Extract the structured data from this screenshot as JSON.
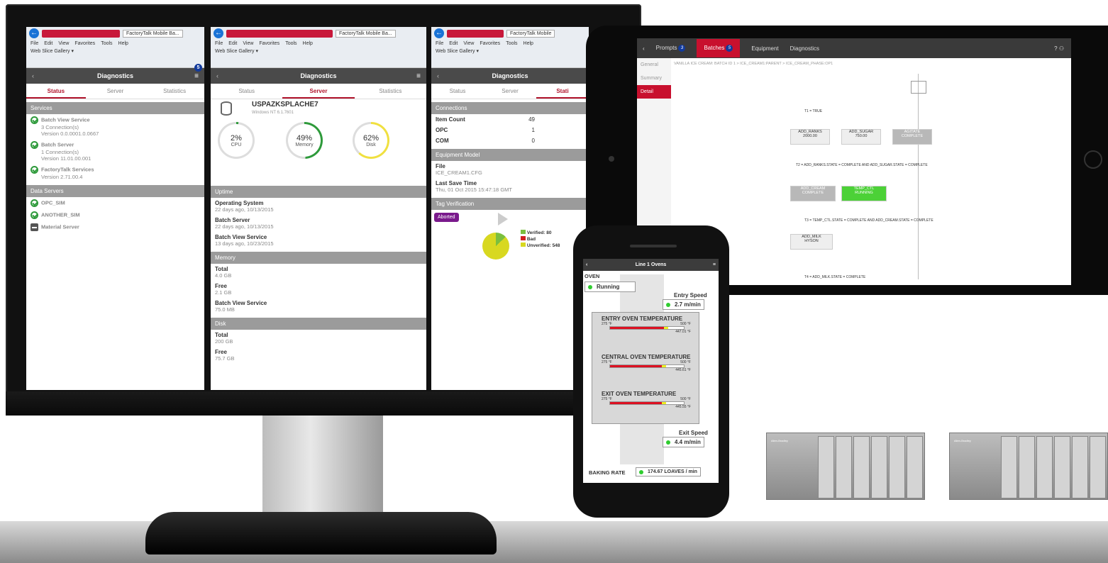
{
  "monitor": {
    "browser": {
      "menu": [
        "File",
        "Edit",
        "View",
        "Favorites",
        "Tools",
        "Help"
      ],
      "favorites": "Web Slice Gallery ▾",
      "tab_title": "FactoryTalk Mobile Ba...",
      "tab_title_short": "FactoryTalk Mobile"
    },
    "panel_left": {
      "title": "Diagnostics",
      "badge": "5",
      "tabs": [
        "Status",
        "Server",
        "Statistics"
      ],
      "services_header": "Services",
      "services": [
        {
          "name": "Batch View Service",
          "line1": "3 Connection(s)",
          "line2": "Version 0.0.0001.0.0667"
        },
        {
          "name": "Batch Server",
          "line1": "1 Connection(s)",
          "line2": "Version 11.01.00.001"
        },
        {
          "name": "FactoryTalk Services",
          "line1": "",
          "line2": "Version 2.71.00.4"
        }
      ],
      "data_servers_header": "Data Servers",
      "data_servers": [
        "OPC_SIM",
        "ANOTHER_SIM",
        "Material Server"
      ]
    },
    "panel_mid": {
      "title": "Diagnostics",
      "tabs": [
        "Status",
        "Server",
        "Statistics"
      ],
      "server_name": "USPAZKSPLACHE7",
      "server_os": "Windows NT 6.1.7601",
      "gauges": [
        {
          "value": "2%",
          "label": "CPU",
          "pct": 2,
          "color": "#2e9a3b"
        },
        {
          "value": "49%",
          "label": "Memory",
          "pct": 49,
          "color": "#2e9a3b"
        },
        {
          "value": "62%",
          "label": "Disk",
          "pct": 62,
          "color": "#f0e040"
        }
      ],
      "uptime_header": "Uptime",
      "uptime": [
        {
          "name": "Operating System",
          "value": "22 days ago, 10/13/2015"
        },
        {
          "name": "Batch Server",
          "value": "22 days ago, 10/13/2015"
        },
        {
          "name": "Batch View Service",
          "value": "13 days ago, 10/23/2015"
        }
      ],
      "memory_header": "Memory",
      "memory": [
        {
          "name": "Total",
          "value": "4.0 GB"
        },
        {
          "name": "Free",
          "value": "2.1 GB"
        },
        {
          "name": "Batch View Service",
          "value": "75.0 MB"
        }
      ],
      "disk_header": "Disk",
      "disk": [
        {
          "name": "Total",
          "value": "200 GB"
        },
        {
          "name": "Free",
          "value": "75.7 GB"
        }
      ]
    },
    "panel_right": {
      "title": "Diagnostics",
      "tabs": [
        "Status",
        "Server",
        "Stati"
      ],
      "connections_header": "Connections",
      "connections": [
        {
          "name": "Item Count",
          "value": "49"
        },
        {
          "name": "OPC",
          "value": "1"
        },
        {
          "name": "COM",
          "value": "0"
        }
      ],
      "equipment_header": "Equipment Model",
      "file_label": "File",
      "file_value": "ICE_CREAM1.CFG",
      "save_label": "Last Save Time",
      "save_value": "Thu, 01 Oct 2015 15:47:18 GMT",
      "tag_header": "Tag Verification",
      "aborted": "Aborted",
      "legend": [
        {
          "label": "Verified: 80",
          "color": "#7bbf3e"
        },
        {
          "label": "Bad",
          "color": "#d12020"
        },
        {
          "label": "Unverified: 548",
          "color": "#d8d820"
        }
      ]
    }
  },
  "tablet": {
    "nav": [
      {
        "label": "Prompts",
        "badge": "3"
      },
      {
        "label": "Batches",
        "badge": "5"
      },
      {
        "label": "Equipment",
        "badge": ""
      },
      {
        "label": "Diagnostics",
        "badge": ""
      }
    ],
    "side": [
      "General",
      "Summary",
      "Detail"
    ],
    "breadcrumb": "VANILLA ICE CREAM: BATCH ID 1  >  ICE_CREAM1:PARENT  >  ICE_CREAM_PHASE:OP1",
    "steps": [
      {
        "label": "ADD_RANKS",
        "sub": "2000.00"
      },
      {
        "label": "ADD_SUGAR",
        "sub": "750.00"
      },
      {
        "label": "AGITATE",
        "sub": "COMPLETE"
      },
      {
        "label": "ADD_CREAM",
        "sub": "COMPLETE"
      },
      {
        "label": "TEMP_CTL",
        "sub": "RUNNING"
      },
      {
        "label": "ADD_MILK",
        "sub": "HYSON"
      }
    ],
    "transitions": [
      "T1 = TRUE",
      "T2 = ADD_RANKS.STATE = COMPLETE AND ADD_SUGAR.STATE = COMPLETE",
      "T3 = TEMP_CTL.STATE = COMPLETE AND ADD_CREAM.STATE = COMPLETE",
      "T4 = ADD_MILK.STATE = COMPLETE"
    ]
  },
  "phone": {
    "title": "Line 1 Ovens",
    "oven_label": "OVEN",
    "oven_state": "Running",
    "entry_speed_label": "Entry Speed",
    "entry_speed": "2.7 m/min",
    "temps": [
      {
        "name": "ENTRY OVEN TEMPERATURE",
        "min": "275 °F",
        "max": "500 °F",
        "value": "447.01 °F",
        "level": 0.79
      },
      {
        "name": "CENTRAL OVEN TEMPERATURE",
        "min": "275 °F",
        "max": "500 °F",
        "value": "445.61 °F",
        "level": 0.76
      },
      {
        "name": "EXIT OVEN TEMPERATURE",
        "min": "275 °F",
        "max": "500 °F",
        "value": "445.55 °F",
        "level": 0.76
      }
    ],
    "exit_speed_label": "Exit Speed",
    "exit_speed": "4.4 m/min",
    "rate_label": "BAKING RATE",
    "rate_value": "174.67 LOAVES / min"
  },
  "plc": {
    "brand": "Allen-Bradley"
  }
}
